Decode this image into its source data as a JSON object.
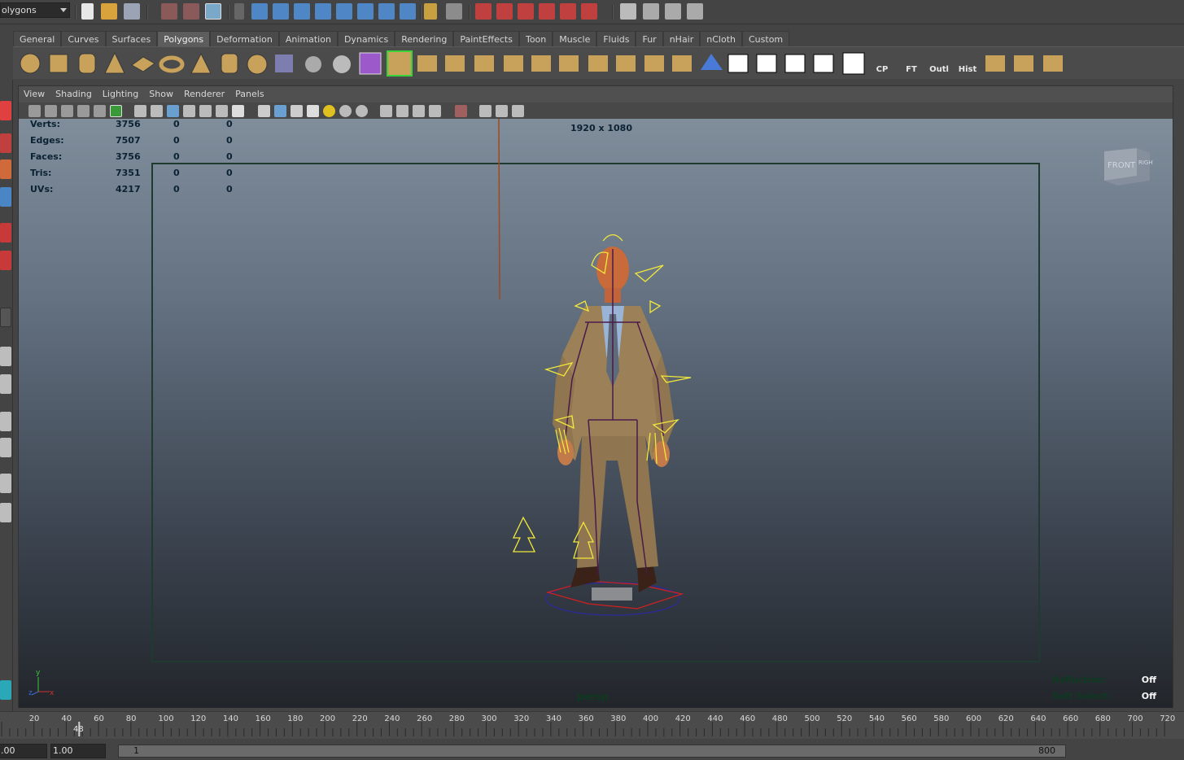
{
  "statusline": {
    "mode": "olygons"
  },
  "shelf": {
    "tabs": [
      "General",
      "Curves",
      "Surfaces",
      "Polygons",
      "Deformation",
      "Animation",
      "Dynamics",
      "Rendering",
      "PaintEffects",
      "Toon",
      "Muscle",
      "Fluids",
      "Fur",
      "nHair",
      "nCloth",
      "Custom"
    ],
    "active_tab": "Polygons",
    "labeled_icons": [
      "CP",
      "FT",
      "Outl",
      "Hist"
    ]
  },
  "panel": {
    "menus": [
      "View",
      "Shading",
      "Lighting",
      "Show",
      "Renderer",
      "Panels"
    ]
  },
  "hud": {
    "stats": [
      {
        "label": "Verts:",
        "v1": "3756",
        "v2": "0",
        "v3": "0"
      },
      {
        "label": "Edges:",
        "v1": "7507",
        "v2": "0",
        "v3": "0"
      },
      {
        "label": "Faces:",
        "v1": "3756",
        "v2": "0",
        "v3": "0"
      },
      {
        "label": "Tris:",
        "v1": "7351",
        "v2": "0",
        "v3": "0"
      },
      {
        "label": "UVs:",
        "v1": "4217",
        "v2": "0",
        "v3": "0"
      }
    ],
    "resolution": "1920 x 1080",
    "camera": "persp",
    "reflection_label": "Reflection:",
    "reflection_value": "Off",
    "soft_select_label": "Soft Select:",
    "soft_select_value": "Off",
    "viewcube_front": "FRONT",
    "viewcube_side": "RIGHT",
    "axis_y": "y",
    "axis_z": "z",
    "axis_x": "x"
  },
  "timeline": {
    "ticks": [
      "20",
      "40",
      "60",
      "80",
      "100",
      "120",
      "140",
      "160",
      "180",
      "200",
      "220",
      "240",
      "260",
      "280",
      "300",
      "320",
      "340",
      "360",
      "380",
      "400",
      "420",
      "440",
      "460",
      "480",
      "500",
      "520",
      "540",
      "560",
      "580",
      "600",
      "620",
      "640",
      "660",
      "680",
      "700",
      "720"
    ],
    "current_frame": "48"
  },
  "range": {
    "start_time": ".00",
    "playback_start": "1.00",
    "range_start": "1",
    "range_end": "800"
  },
  "colors": {
    "accent": "#5d5d5d",
    "rig_yellow": "#f2e83a",
    "hud_text": "#0b2233"
  }
}
